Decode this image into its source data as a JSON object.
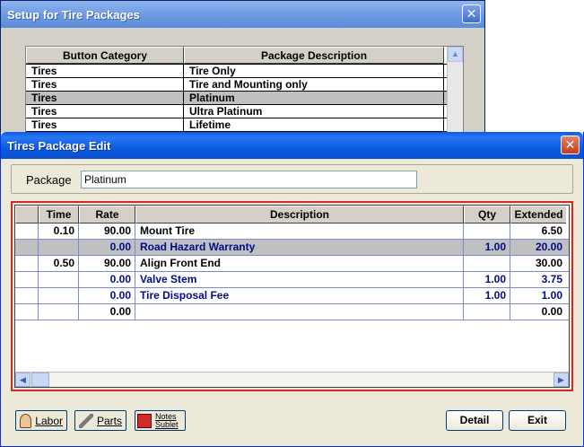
{
  "background_window": {
    "title": "Setup for Tire Packages",
    "columns": [
      "Button Category",
      "Package Description"
    ],
    "rows": [
      {
        "category": "Tires",
        "description": "Tire Only"
      },
      {
        "category": "Tires",
        "description": "Tire and Mounting only"
      },
      {
        "category": "Tires",
        "description": "Platinum"
      },
      {
        "category": "Tires",
        "description": "Ultra Platinum"
      },
      {
        "category": "Tires",
        "description": "Lifetime"
      }
    ],
    "selected_row": 2
  },
  "dialog": {
    "title": "Tires Package Edit",
    "close_glyph": "✕",
    "package_label": "Package",
    "package_value": "Platinum",
    "columns": {
      "time": "Time",
      "rate": "Rate",
      "description": "Description",
      "qty": "Qty",
      "extended": "Extended"
    },
    "rows": [
      {
        "time": "0.10",
        "rate": "90.00",
        "description": "Mount Tire",
        "qty": "",
        "extended": "6.50"
      },
      {
        "time": "",
        "rate": "0.00",
        "description": "Road Hazard Warranty",
        "qty": "1.00",
        "extended": "20.00"
      },
      {
        "time": "0.50",
        "rate": "90.00",
        "description": "Align Front End",
        "qty": "",
        "extended": "30.00"
      },
      {
        "time": "",
        "rate": "0.00",
        "description": "Valve Stem",
        "qty": "1.00",
        "extended": "3.75"
      },
      {
        "time": "",
        "rate": "0.00",
        "description": "Tire Disposal Fee",
        "qty": "1.00",
        "extended": "1.00"
      },
      {
        "time": "",
        "rate": "0.00",
        "description": "",
        "qty": "",
        "extended": "0.00"
      }
    ],
    "buttons": {
      "labor": "Labor",
      "parts": "Parts",
      "notes_line1": "Notes",
      "notes_line2": "Sublet",
      "detail": "Detail",
      "exit": "Exit"
    },
    "colors": {
      "title_bar": "#0a5be6",
      "grid_highlight": "#d22a2a",
      "part_text": "#000a8a"
    }
  }
}
